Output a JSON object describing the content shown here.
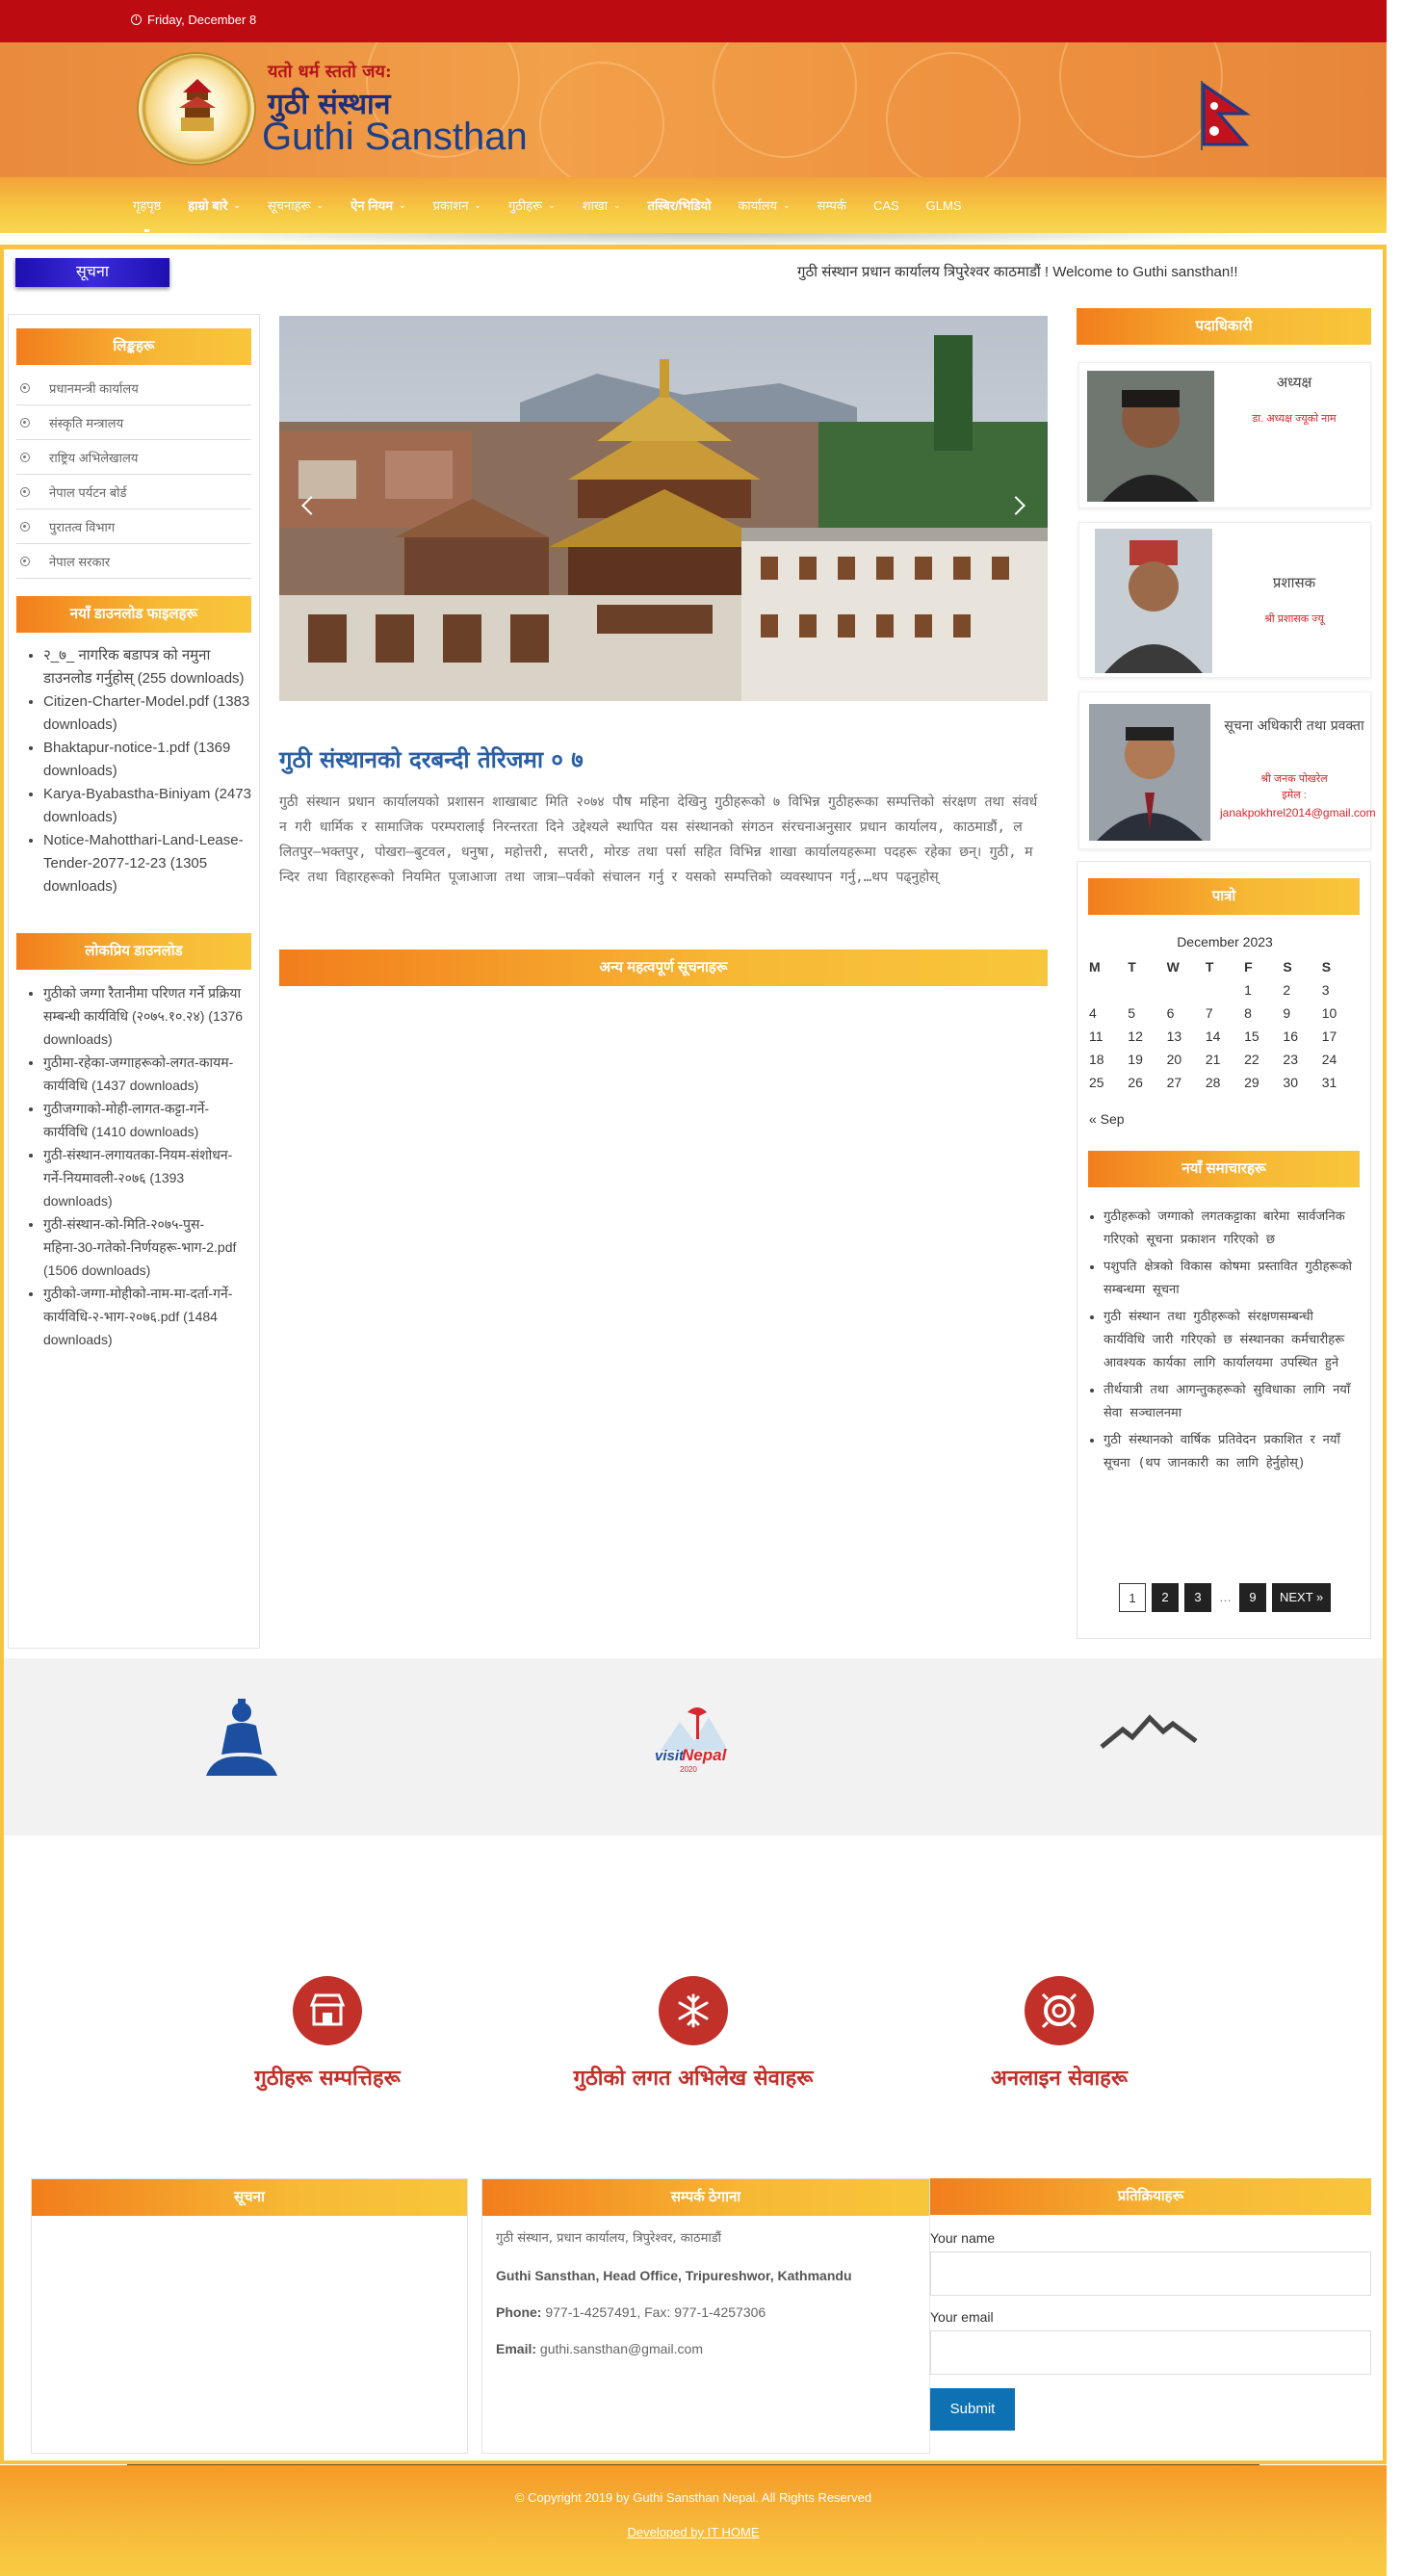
{
  "top_bar": {
    "date": "Friday, December 8"
  },
  "brand": {
    "motto": "यतो धर्म स्ततो जय:",
    "name_np": "गुठी संस्थान",
    "name_en": "Guthi Sansthan"
  },
  "nav": {
    "items": [
      {
        "label": "गृहपृष्ठ",
        "dropdown": false,
        "bold": false,
        "active": true
      },
      {
        "label": "हाम्रो बारे",
        "dropdown": true,
        "bold": true
      },
      {
        "label": "सूचनाहरू",
        "dropdown": true,
        "bold": false
      },
      {
        "label": "ऐन नियम",
        "dropdown": true,
        "bold": true
      },
      {
        "label": "प्रकाशन",
        "dropdown": true,
        "bold": false
      },
      {
        "label": "गुठीहरू",
        "dropdown": true,
        "bold": false
      },
      {
        "label": "शाखा",
        "dropdown": true,
        "bold": false
      },
      {
        "label": "तस्बिर/भिडियो",
        "dropdown": false,
        "bold": true
      },
      {
        "label": "कार्यालय",
        "dropdown": true,
        "bold": false
      },
      {
        "label": "सम्पर्क",
        "dropdown": false,
        "bold": false
      },
      {
        "label": "CAS",
        "dropdown": false,
        "bold": false
      },
      {
        "label": "GLMS",
        "dropdown": false,
        "bold": false
      }
    ]
  },
  "notice": {
    "label": "सूचना",
    "ticker": "गुठी संस्थान प्रधान कार्यालय त्रिपुरेश्वर काठमाडौं ! Welcome to Guthi sansthan!!"
  },
  "left_sidebar": {
    "links_title": "लिङ्कहरू",
    "links": [
      "प्रधानमन्त्री कार्यालय",
      "संस्कृति मन्त्रालय",
      "राष्ट्रिय अभिलेखालय",
      "नेपाल पर्यटन बोर्ड",
      "पुरातत्व विभाग",
      "नेपाल सरकार"
    ],
    "downloads_title": "नयाँ डाउनलोड फाइलहरू",
    "downloads": [
      "२_७_ नागरिक बडापत्र को नमुना डाउनलोड गर्नुहोस् (255 downloads)",
      "Citizen-Charter-Model.pdf (1383 downloads)",
      "Bhaktapur-notice-1.pdf (1369 downloads)",
      "Karya-Byabastha-Biniyam (2473 downloads)",
      "Notice-Mahotthari-Land-Lease-Tender-2077-12-23 (1305 downloads)"
    ],
    "popular_title": "लोकप्रिय डाउनलोड",
    "popular": [
      "गुठीको जग्गा रैतानीमा परिणत गर्ने प्रक्रिया सम्बन्धी कार्यविधि (२०७५.१०.२४) (1376 downloads)",
      "गुठीमा-रहेका-जग्गाहरूको-लगत-कायम-कार्यविधि (1437 downloads)",
      "गुठीजग्गाको-मोही-लागत-कट्टा-गर्ने-कार्यविधि (1410 downloads)",
      "गुठी-संस्थान-लगायतका-नियम-संशोधन-गर्ने-नियमावली-२०७६ (1393 downloads)",
      "गुठी-संस्थान-को-मिति-२०७५-पुस-महिना-30-गतेको-निर्णयहरू-भाग-2.pdf (1506 downloads)",
      "गुठीको-जग्गा-मोहीको-नाम-मा-दर्ता-गर्ने-कार्यविधि-२-भाग-२०७६.pdf (1484 downloads)"
    ]
  },
  "main": {
    "post_title": "गुठी संस्थानको दरबन्दी तेरिजमा ० ७",
    "post_body": "गुठी संस्थान प्रधान कार्यालयको प्रशासन शाखाबाट मिति २०७४ पौष महिना देखिनु गुठीहरूको ७ विभिन्न गुठीहरूका सम्पत्तिको संरक्षण तथा संवर्धन गरी धार्मिक र सामाजिक परम्परालाई निरन्तरता दिने उद्देश्यले स्थापित यस संस्थानको संगठन संरचनाअनुसार प्रधान कार्यालय, काठमाडौं, ललितपुर–भक्तपुर, पोखरा–बुटवल, धनुषा, महोत्तरी, सप्तरी, मोरङ तथा पर्सा सहित विभिन्न शाखा कार्यालयहरूमा पदहरू रहेका छन्। गुठी, मन्दिर तथा विहारहरूको नियमित पूजाआजा तथा जात्रा–पर्वको संचालन गर्नु र यसको सम्पत्तिको व्यवस्थापन गर्नु,…",
    "read_more": "थप पढ्नुहोस्",
    "news_section_title": "अन्य महत्वपूर्ण सूचनाहरू"
  },
  "right_sidebar": {
    "officials_title": "पदाधिकारी",
    "officials": [
      {
        "name": "अध्यक्ष",
        "title": "डा. अध्यक्ष ज्यूको नाम"
      },
      {
        "name": "प्रशासक",
        "title": "श्री प्रशासक ज्यू"
      },
      {
        "name": "सूचना अधिकारी तथा प्रवक्ता",
        "title": "श्री जनक पोखरेल",
        "email_label": "इमेल :",
        "email": "janakpokhrel2014@gmail.com"
      }
    ],
    "calendar_title": "पात्रो",
    "calendar": {
      "month": "December 2023",
      "weekdays": [
        "M",
        "T",
        "W",
        "T",
        "F",
        "S",
        "S"
      ],
      "weeks": [
        [
          "",
          "",
          "",
          "",
          "1",
          "2",
          "3"
        ],
        [
          "4",
          "5",
          "6",
          "7",
          "8",
          "9",
          "10"
        ],
        [
          "11",
          "12",
          "13",
          "14",
          "15",
          "16",
          "17"
        ],
        [
          "18",
          "19",
          "20",
          "21",
          "22",
          "23",
          "24"
        ],
        [
          "25",
          "26",
          "27",
          "28",
          "29",
          "30",
          "31"
        ]
      ],
      "prev": "« Sep"
    },
    "news_title": "नयाँ समाचारहरू",
    "news": [
      "गुठीहरूको जग्गाको लगतकट्टाका बारेमा सार्वजनिक गरिएको सूचना प्रकाशन गरिएको छ",
      "पशुपति क्षेत्रको विकास कोषमा प्रस्तावित गुठीहरूको सम्बन्धमा सूचना",
      "गुठी संस्थान तथा गुठीहरूको संरक्षणसम्बन्धी कार्यविधि जारी गरिएको छ संस्थानका कर्मचारीहरू आवश्यक कार्यका लागि कार्यालयमा उपस्थित हुने",
      "तीर्थयात्री तथा आगन्तुकहरूको सुविधाका लागि नयाँ सेवा सञ्चालनमा",
      "गुठी संस्थानको वार्षिक प्रतिवेदन प्रकाशित र नयाँ सूचना (थप जानकारी का लागि हेर्नुहोस्)"
    ],
    "pager": [
      "1",
      "2",
      "3",
      "…",
      "9",
      "NEXT »"
    ]
  },
  "services": [
    {
      "label": "गुठीहरू सम्पत्तिहरू",
      "icon": "store-icon"
    },
    {
      "label": "गुठीको लगत अभिलेख सेवाहरू",
      "icon": "snowflake-icon"
    },
    {
      "label": "अनलाइन सेवाहरू",
      "icon": "lifebuoy-icon"
    }
  ],
  "footer_widgets": {
    "notice_title": "सूचना",
    "contact_title": "सम्पर्क ठेगाना",
    "contact_np": "गुठी संस्थान, प्रधान कार्यालय, त्रिपुरेश्वर, काठमाडौं",
    "contact_en": "Guthi Sansthan, Head Office, Tripureshwor, Kathmandu",
    "phone_label": "Phone:",
    "phone": "977-1-4257491, Fax: 977-1-4257306",
    "email_label": "Email:",
    "email": "guthi.sansthan@gmail.com",
    "feedback_title": "प्रतिक्रियाहरू",
    "name_label": "Your name",
    "email_field_label": "Your email",
    "submit": "Submit"
  },
  "footer": {
    "copyright": "© Copyright 2019 by Guthi Sansthan Nepal. All Rights Reserved",
    "developer": "Developed by IT HOME"
  },
  "colors": {
    "red": "#bd0b12",
    "orange": "#f27d1c",
    "yellow": "#f8c63a",
    "link_blue": "#2a5fa3",
    "service_red": "#c2302a",
    "button_blue": "#0d71b3"
  }
}
